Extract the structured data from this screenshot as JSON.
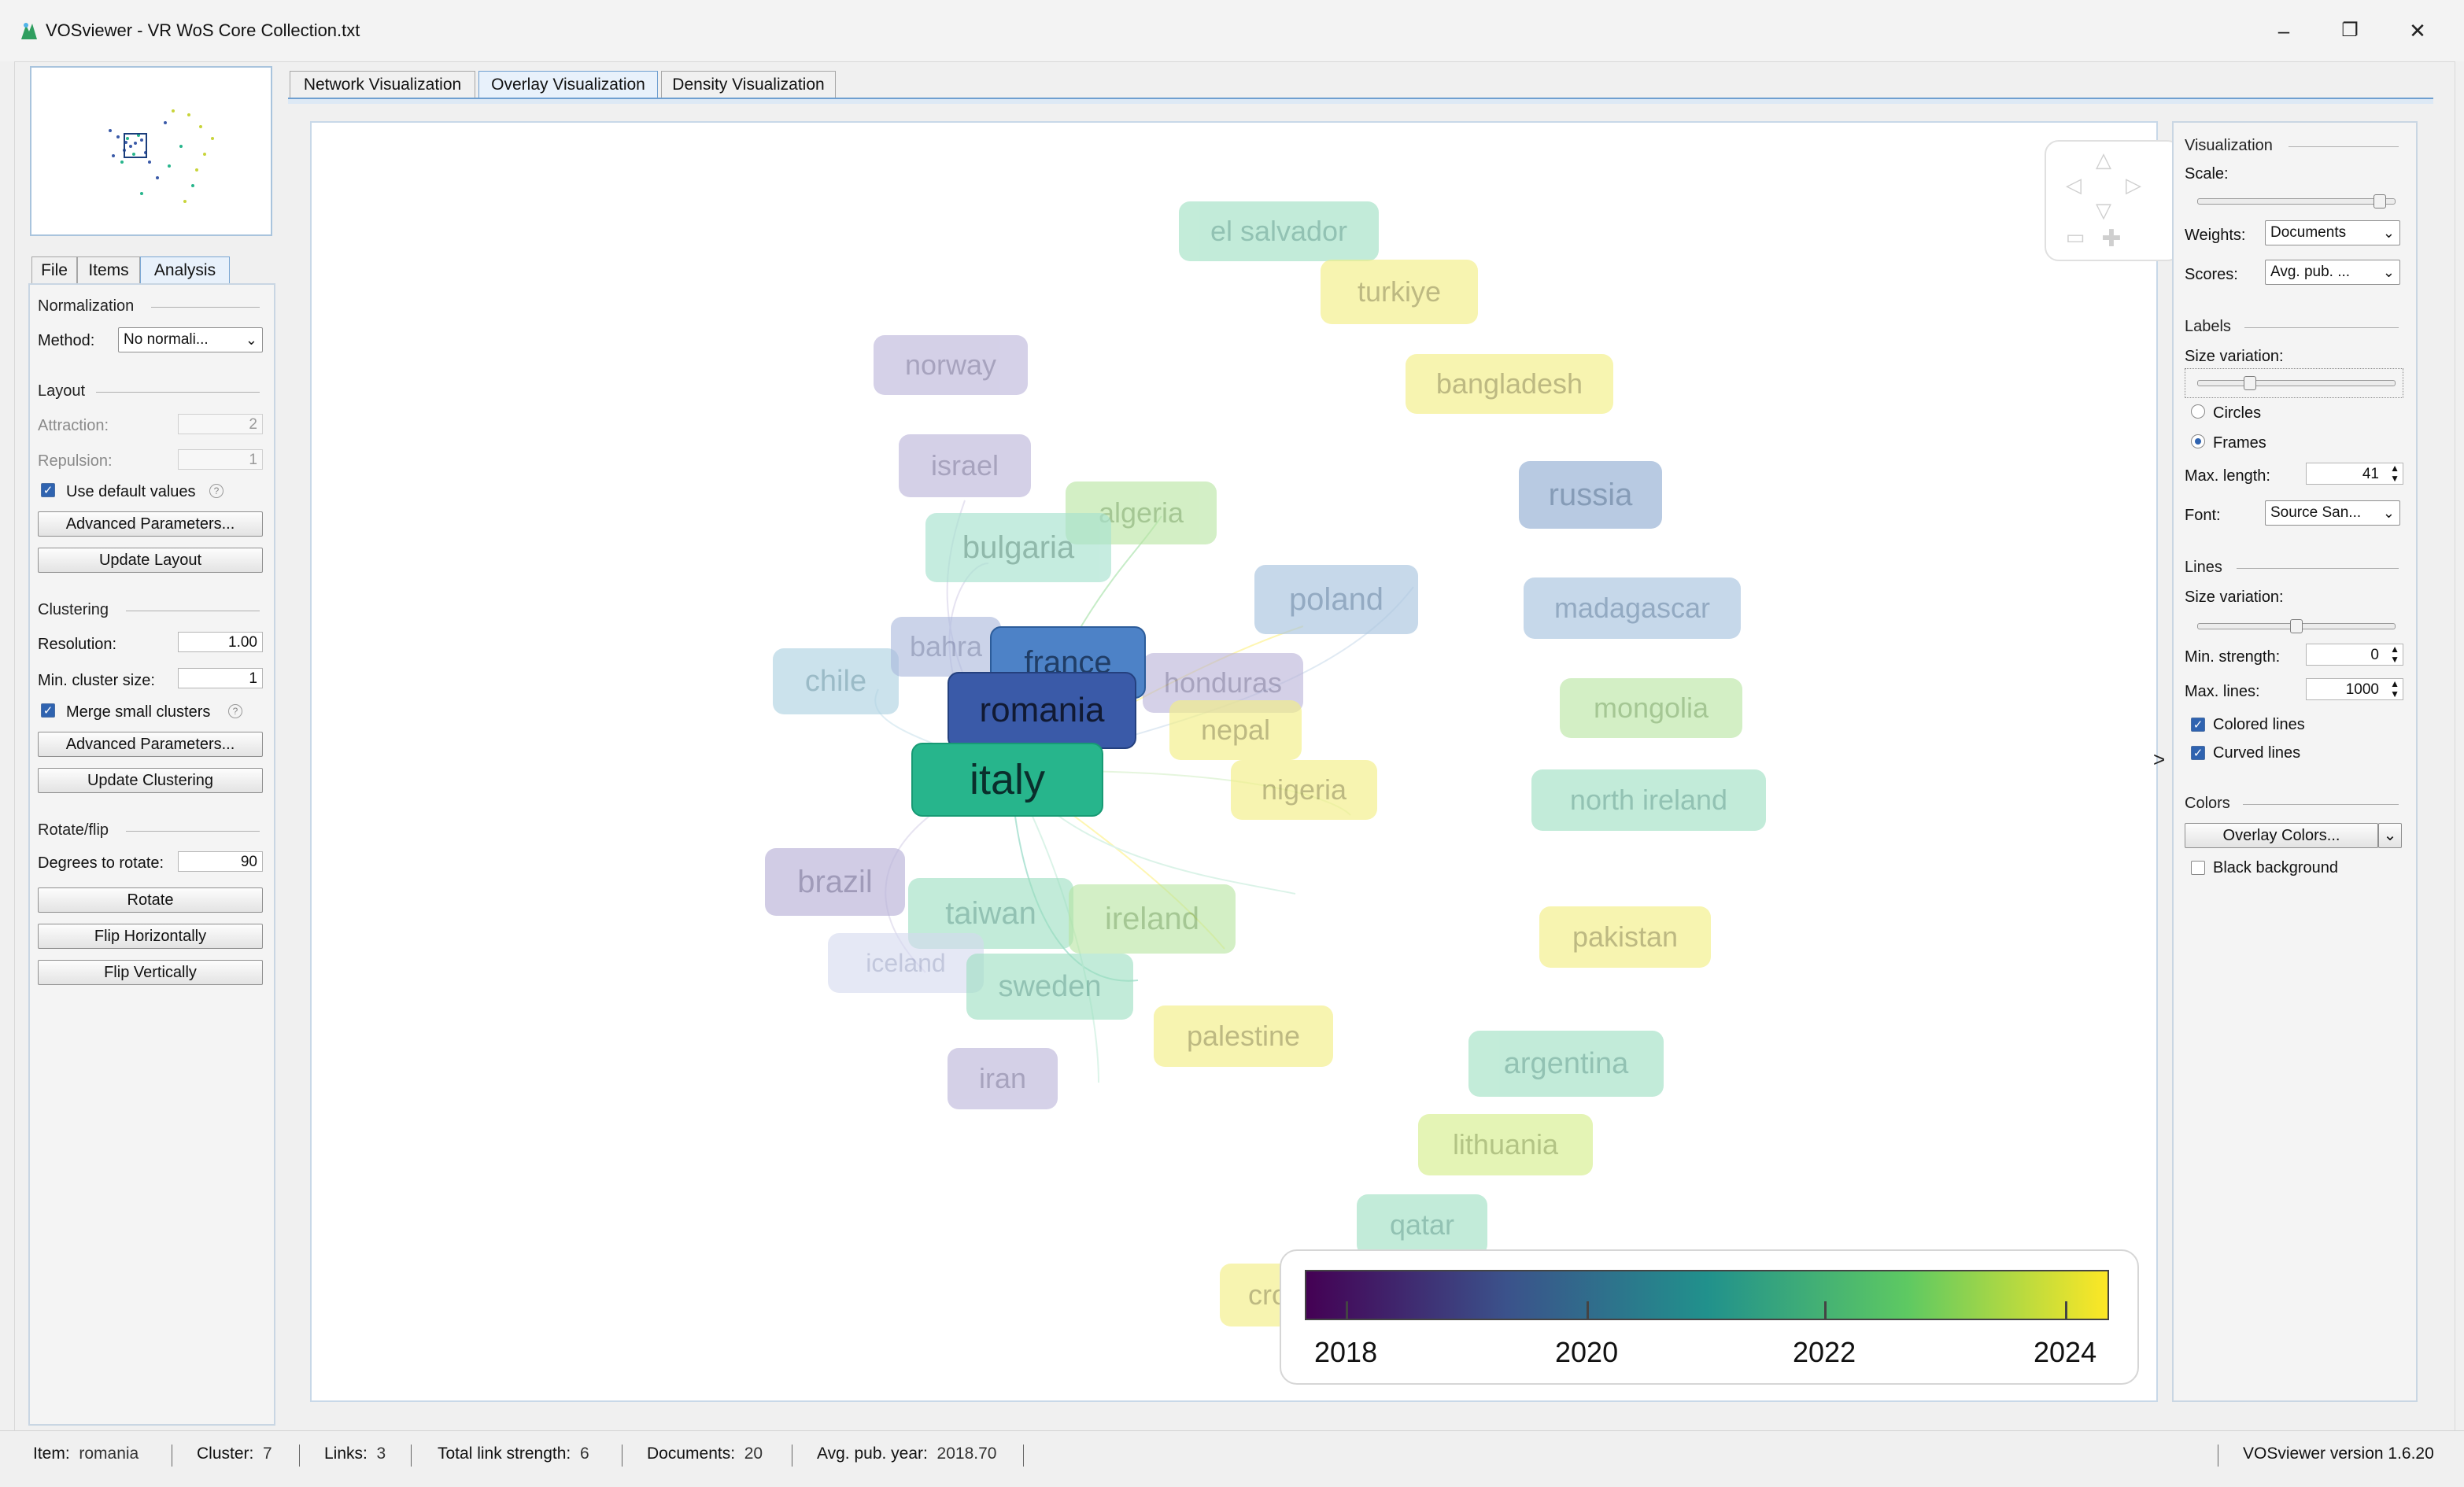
{
  "window": {
    "title": "VOSviewer - VR WoS Core Collection.txt",
    "minimize_glyph": "–",
    "restore_glyph": "❐",
    "close_glyph": "✕"
  },
  "left_tabs": [
    "File",
    "Items",
    "Analysis"
  ],
  "analysis": {
    "normalization_header": "Normalization",
    "method_label": "Method:",
    "method_value": "No normali...",
    "layout_header": "Layout",
    "attraction_label": "Attraction:",
    "attraction_value": "2",
    "repulsion_label": "Repulsion:",
    "repulsion_value": "1",
    "use_default_label": "Use default values",
    "advanced_params_label": "Advanced Parameters...",
    "update_layout_label": "Update Layout",
    "clustering_header": "Clustering",
    "resolution_label": "Resolution:",
    "resolution_value": "1.00",
    "min_cluster_label": "Min. cluster size:",
    "min_cluster_value": "1",
    "merge_small_label": "Merge small clusters",
    "advanced_params2_label": "Advanced Parameters...",
    "update_clustering_label": "Update Clustering",
    "rotate_header": "Rotate/flip",
    "degrees_label": "Degrees to rotate:",
    "degrees_value": "90",
    "rotate_label": "Rotate",
    "flip_h_label": "Flip Horizontally",
    "flip_v_label": "Flip Vertically"
  },
  "top_tabs": [
    "Network Visualization",
    "Overlay Visualization",
    "Density Visualization"
  ],
  "nodes": [
    {
      "label": "el salvador",
      "color": "#9bdfc0"
    },
    {
      "label": "turkiye",
      "color": "#f3ef86"
    },
    {
      "label": "norway",
      "color": "#b9b2d8"
    },
    {
      "label": "bangladesh",
      "color": "#f3ef86"
    },
    {
      "label": "israel",
      "color": "#b9b2d8"
    },
    {
      "label": "algeria",
      "color": "#b6e5a0"
    },
    {
      "label": "bulgaria",
      "color": "#a7e2cf"
    },
    {
      "label": "russia",
      "color": "#9bb5d6"
    },
    {
      "label": "poland",
      "color": "#a9c4df"
    },
    {
      "label": "madagascar",
      "color": "#a9c4df"
    },
    {
      "label": "chile",
      "color": "#a9cfe0"
    },
    {
      "label": "bahra",
      "color": "#a9b7dc"
    },
    {
      "label": "honduras",
      "color": "#b9b2d8"
    },
    {
      "label": "france",
      "color": "#4d82c7"
    },
    {
      "label": "romania",
      "color": "#3a5aa8"
    },
    {
      "label": "nepal",
      "color": "#f3ef86"
    },
    {
      "label": "mongolia",
      "color": "#b6e5a0"
    },
    {
      "label": "italy",
      "color": "#27b58c"
    },
    {
      "label": "nigeria",
      "color": "#f3ef86"
    },
    {
      "label": "north ireland",
      "color": "#9bdfc0"
    },
    {
      "label": "brazil",
      "color": "#b9b2d8"
    },
    {
      "label": "taiwan",
      "color": "#9bdfc0"
    },
    {
      "label": "ireland",
      "color": "#b6e5a0"
    },
    {
      "label": "pakistan",
      "color": "#f3ef86"
    },
    {
      "label": "iceland",
      "color": "#d5daf0"
    },
    {
      "label": "sweden",
      "color": "#9bdfc0"
    },
    {
      "label": "palestine",
      "color": "#f3ef86"
    },
    {
      "label": "argentina",
      "color": "#9bdfc0"
    },
    {
      "label": "iran",
      "color": "#b9b2d8"
    },
    {
      "label": "lithuania",
      "color": "#d6ef8e"
    },
    {
      "label": "qatar",
      "color": "#9bdfc0"
    },
    {
      "label": "cro",
      "color": "#f3ef86"
    }
  ],
  "legend": {
    "labels": [
      "2018",
      "2020",
      "2022",
      "2024"
    ],
    "colormap": [
      "#440154",
      "#3b528b",
      "#21918c",
      "#5ec962",
      "#fde725"
    ]
  },
  "right_panel": {
    "visualization_header": "Visualization",
    "scale_label": "Scale:",
    "scale_level": 0.95,
    "weights_label": "Weights:",
    "weights_value": "Documents",
    "scores_label": "Scores:",
    "scores_value": "Avg. pub. ...",
    "labels_header": "Labels",
    "label_size_variation_label": "Size variation:",
    "label_size_level": 0.25,
    "circles_label": "Circles",
    "frames_label": "Frames",
    "max_length_label": "Max. length:",
    "max_length_value": "41",
    "font_label": "Font:",
    "font_value": "Source San...",
    "lines_header": "Lines",
    "line_size_variation_label": "Size variation:",
    "line_size_level": 0.5,
    "min_strength_label": "Min. strength:",
    "min_strength_value": "0",
    "max_lines_label": "Max. lines:",
    "max_lines_value": "1000",
    "colored_lines_label": "Colored lines",
    "curved_lines_label": "Curved lines",
    "colors_header": "Colors",
    "overlay_colors_label": "Overlay Colors...",
    "black_background_label": "Black background",
    "collapse_glyph": ">"
  },
  "status": {
    "item_label": "Item:",
    "item_value": "romania",
    "cluster_label": "Cluster:",
    "cluster_value": "7",
    "links_label": "Links:",
    "links_value": "3",
    "tls_label": "Total link strength:",
    "tls_value": "6",
    "docs_label": "Documents:",
    "docs_value": "20",
    "avg_label": "Avg. pub. year:",
    "avg_value": "2018.70",
    "version": "VOSviewer version 1.6.20"
  },
  "icons": [
    "vosviewer-logo-icon",
    "minimize-icon",
    "restore-icon",
    "close-icon",
    "pan-up-icon",
    "pan-down-icon",
    "pan-left-icon",
    "pan-right-icon",
    "zoom-out-icon",
    "zoom-in-icon",
    "help-icon",
    "dropdown-chevron-icon"
  ]
}
